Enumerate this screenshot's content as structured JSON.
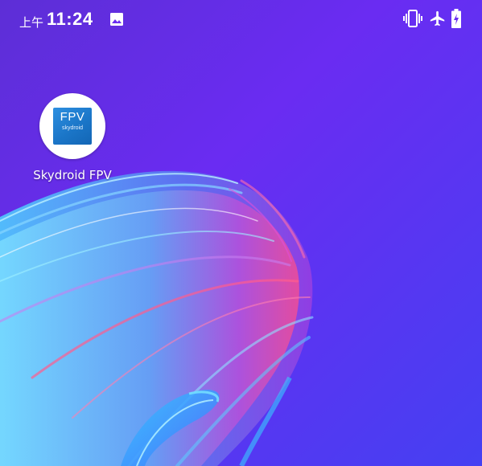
{
  "status_bar": {
    "time_prefix": "上午",
    "time": "11:24",
    "icons": [
      "gallery-icon",
      "vibrate-icon",
      "airplane-icon",
      "battery-charging-icon"
    ],
    "color": "#ffffff"
  },
  "home_screen": {
    "apps": [
      {
        "label": "Skydroid FPV",
        "icon": "skydroid-fpv-icon",
        "logo_main": "FPV",
        "logo_sub": "skydroid"
      }
    ]
  },
  "colors": {
    "wallpaper_top": "#6b2cf0",
    "wallpaper_bottom": "#4a3ff0",
    "logo_blue": "#1b76c8"
  }
}
